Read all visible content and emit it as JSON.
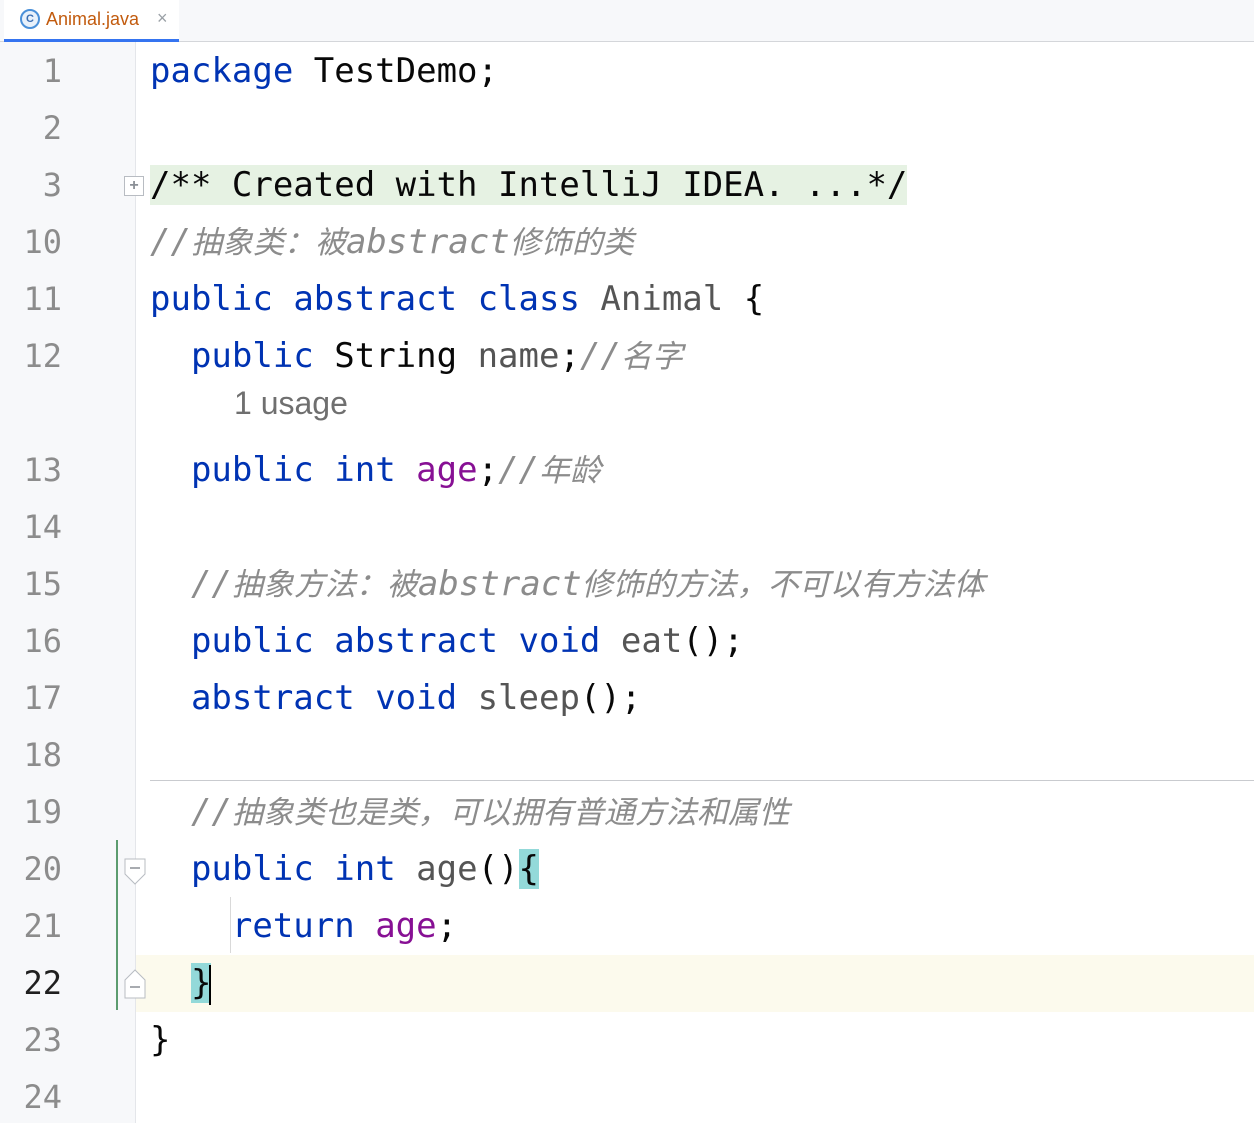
{
  "tab": {
    "icon": "java-class-icon",
    "icon_letter": "C",
    "label": "Animal.java",
    "close": "×"
  },
  "gutter": {
    "line_numbers": [
      "1",
      "2",
      "3",
      "10",
      "11",
      "12",
      "",
      "13",
      "14",
      "15",
      "16",
      "17",
      "18",
      "19",
      "20",
      "21",
      "22",
      "23",
      "24"
    ],
    "current_line": "22"
  },
  "code": {
    "l1": {
      "kw": "package",
      "rest": " TestDemo;"
    },
    "l3": {
      "folded": "/** Created with IntelliJ IDEA. ...*/"
    },
    "l10": {
      "slash": "//",
      "c1": "抽象类：被",
      "word": "abstract",
      "c2": "修饰的类"
    },
    "l11": {
      "kw1": "public",
      "kw2": "abstract",
      "kw3": "class",
      "name": "Animal",
      "brace": "{"
    },
    "l12": {
      "kw": "public",
      "type": "String",
      "field": "name",
      "semi": ";",
      "slash": "//",
      "comment": "名字"
    },
    "usage_hint": "1 usage",
    "l13": {
      "kw1": "public",
      "kw2": "int",
      "field": "age",
      "semi": ";",
      "slash": "//",
      "comment": "年龄"
    },
    "l15": {
      "slash": "//",
      "c1": "抽象方法：被",
      "word": "abstract",
      "c2": "修饰的方法，不可以有方法体"
    },
    "l16": {
      "kw1": "public",
      "kw2": "abstract",
      "kw3": "void",
      "method": "eat",
      "rest": "();"
    },
    "l17": {
      "kw1": "abstract",
      "kw2": "void",
      "method": "sleep",
      "rest": "();"
    },
    "l19": {
      "slash": "//",
      "comment": "抽象类也是类，可以拥有普通方法和属性"
    },
    "l20": {
      "kw1": "public",
      "kw2": "int",
      "method": "age",
      "paren": "()",
      "brace": "{"
    },
    "l21": {
      "kw": "return",
      "field": "age",
      "semi": ";"
    },
    "l22": {
      "brace": "}"
    },
    "l23": {
      "brace": "}"
    }
  },
  "colors": {
    "keyword": "#0033b3",
    "field": "#871094",
    "comment": "#8c8c8c",
    "brace_highlight": "#93d9d9",
    "folded_background": "#e6f2e3",
    "current_line_background": "#fcfaed"
  }
}
